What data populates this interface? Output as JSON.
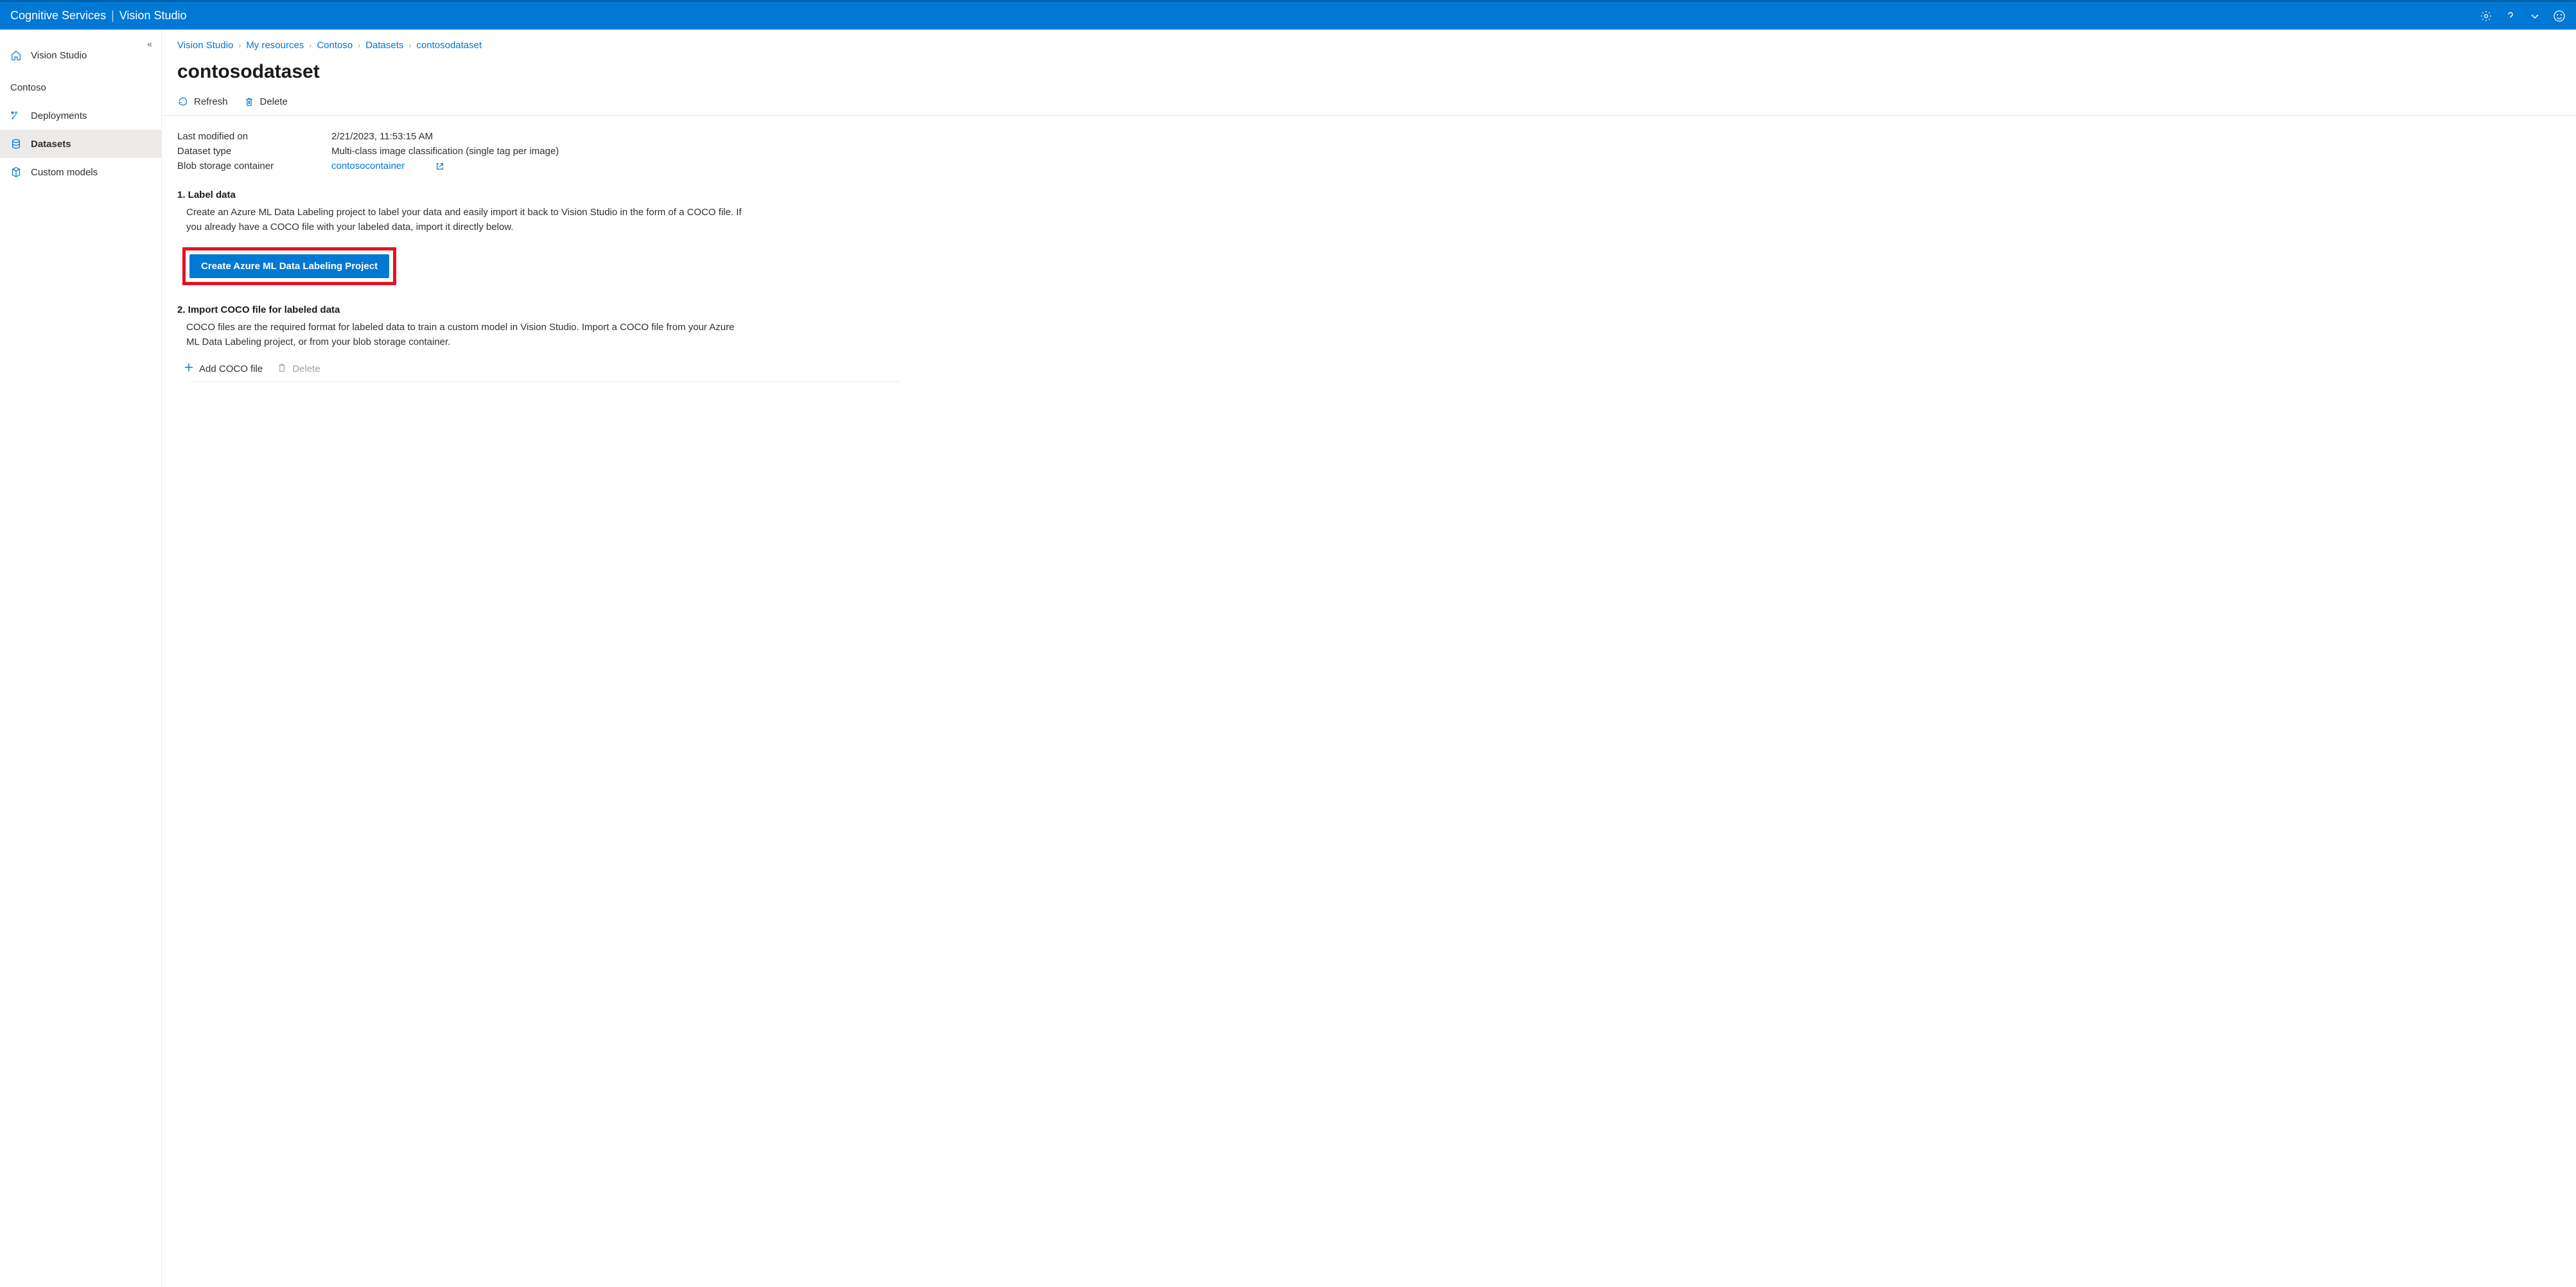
{
  "header": {
    "product": "Cognitive Services",
    "app": "Vision Studio"
  },
  "sidebar": {
    "home_label": "Vision Studio",
    "resource_label": "Contoso",
    "items": [
      {
        "label": "Deployments"
      },
      {
        "label": "Datasets"
      },
      {
        "label": "Custom models"
      }
    ]
  },
  "breadcrumb": {
    "items": [
      {
        "label": "Vision Studio"
      },
      {
        "label": "My resources"
      },
      {
        "label": "Contoso"
      },
      {
        "label": "Datasets"
      }
    ],
    "current": "contosodataset"
  },
  "page": {
    "title": "contosodataset",
    "toolbar": {
      "refresh": "Refresh",
      "delete": "Delete"
    },
    "details": {
      "last_modified_label": "Last modified on",
      "last_modified_value": "2/21/2023, 11:53:15 AM",
      "dataset_type_label": "Dataset type",
      "dataset_type_value": "Multi-class image classification (single tag per image)",
      "blob_label": "Blob storage container",
      "blob_value": "contosocontainer"
    },
    "section1": {
      "heading": "1. Label data",
      "text": "Create an Azure ML Data Labeling project to label your data and easily import it back to Vision Studio in the form of a COCO file. If you already have a COCO file with your labeled data, import it directly below.",
      "button": "Create Azure ML Data Labeling Project"
    },
    "section2": {
      "heading": "2. Import COCO file for labeled data",
      "text": "COCO files are the required format for labeled data to train a custom model in Vision Studio. Import a COCO file from your Azure ML Data Labeling project, or from your blob storage container.",
      "add_coco": "Add COCO file",
      "delete": "Delete"
    }
  }
}
